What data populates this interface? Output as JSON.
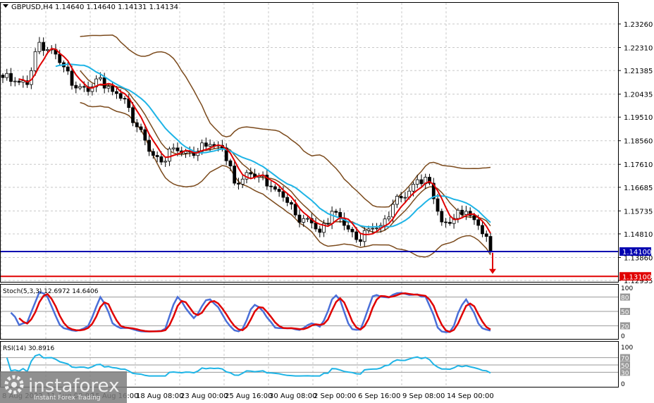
{
  "window": {
    "title": "GBPUSD,H4",
    "ohlc": "1.14640 1.14640 1.14131 1.14134"
  },
  "colors": {
    "candle": "#000000",
    "bands": "#7b4a1c",
    "fast_ma": "#e00000",
    "slow_ma": "#1eb4e6",
    "support": "#0000b0",
    "target": "#e00000",
    "stoch_k": "#4a6fd8",
    "stoch_d": "#e00000",
    "rsi": "#1eb4e6"
  },
  "chart_data": {
    "type": "candlestick",
    "title": "GBPUSD,H4",
    "price_axis_labels": [
      "1.23260",
      "1.22310",
      "1.21385",
      "1.20435",
      "1.19510",
      "1.18560",
      "1.17610",
      "1.16685",
      "1.15735",
      "1.14810",
      "1.13860",
      "1.12935"
    ],
    "ylim": [
      1.1255,
      1.242
    ],
    "time_labels": [
      "8 Aug 2022",
      "11 Aug 00:00",
      "15 Aug 16:00",
      "18 Aug 08:00",
      "23 Aug 00:00",
      "25 Aug 16:00",
      "30 Aug 08:00",
      "2 Sep 00:00",
      "6 Sep 16:00",
      "9 Sep 08:00",
      "14 Sep 00:00"
    ],
    "closes": [
      1.211,
      1.2096,
      1.2082,
      1.2252,
      1.2224,
      1.2153,
      1.2068,
      1.2054,
      1.211,
      1.2054,
      1.2025,
      1.1912,
      1.1813,
      1.177,
      1.1827,
      1.1813,
      1.1813,
      1.1841,
      1.1827,
      1.1685,
      1.1728,
      1.1713,
      1.1671,
      1.1628,
      1.1557,
      1.1543,
      1.1487,
      1.1572,
      1.1515,
      1.1458,
      1.1501,
      1.1515,
      1.16,
      1.1628,
      1.1699,
      1.1685,
      1.1529,
      1.1543,
      1.1572,
      1.1515,
      1.1413
    ],
    "horizontal_lines": [
      {
        "name": "support",
        "price": 1.141,
        "label": "1.14100"
      },
      {
        "name": "target",
        "price": 1.131,
        "label": "1.13100"
      }
    ],
    "arrow": {
      "direction": "down",
      "from_price": 1.1405,
      "to_price": 1.132
    },
    "stochastic": {
      "label": "Stoch(5,3,3) 12.6972 14.6406",
      "levels": [
        "80",
        "50",
        "20"
      ],
      "scale": [
        "100",
        "0"
      ]
    },
    "rsi": {
      "label": "RSI(14) 30.8916",
      "levels": [
        "70",
        "50",
        "30"
      ],
      "scale": [
        "100",
        "0"
      ]
    }
  },
  "logo": {
    "name": "instaforex",
    "tagline": "Instant Forex Trading"
  }
}
